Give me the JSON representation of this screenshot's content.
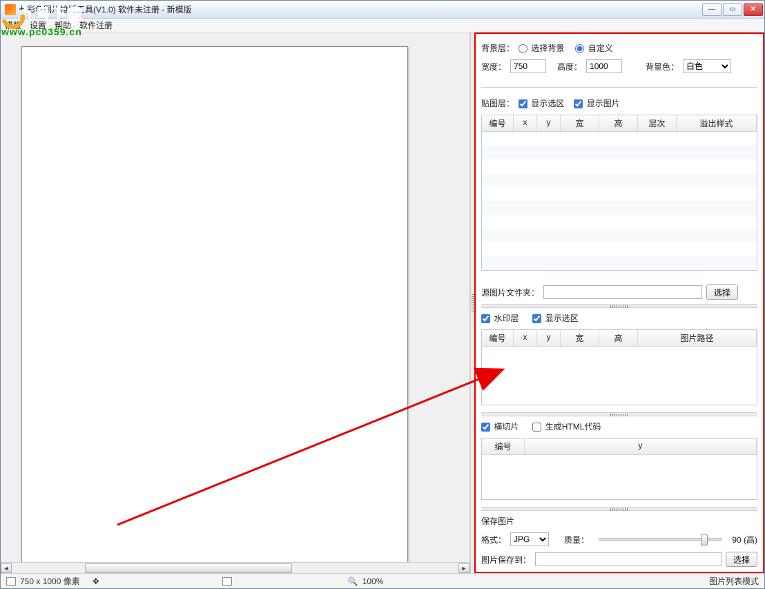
{
  "window": {
    "title": "七彩色图片排版工具(V1.0)    软件未注册 - 新模版"
  },
  "menu": {
    "template": "模版",
    "settings": "设置",
    "help": "帮助",
    "register": "软件注册"
  },
  "watermark": {
    "text1": "九号下载",
    "text2": "www.pc0359.cn"
  },
  "side": {
    "bg": {
      "label": "背景层：",
      "opt_select": "选择背景",
      "opt_custom": "自定义",
      "width_label": "宽度：",
      "width_value": "750",
      "height_label": "高度：",
      "height_value": "1000",
      "color_label": "背景色：",
      "color_value": "白色"
    },
    "paste": {
      "label": "贴图层：",
      "show_area": "显示选区",
      "show_img": "显示图片",
      "cols": {
        "num": "编号",
        "x": "x",
        "y": "y",
        "w": "宽",
        "h": "高",
        "lvl": "层次",
        "ov": "溢出样式"
      }
    },
    "srcfolder": {
      "label": "源图片文件夹：",
      "value": "",
      "btn": "选择"
    },
    "wm": {
      "label": "水印层",
      "show_area": "显示选区",
      "cols": {
        "num": "编号",
        "x": "x",
        "y": "y",
        "w": "宽",
        "h": "高",
        "path": "图片路径"
      }
    },
    "slice": {
      "label": "横切片",
      "gen_html": "生成HTML代码",
      "cols": {
        "num": "编号",
        "y": "y"
      }
    },
    "save": {
      "label": "保存图片",
      "fmt_label": "格式：",
      "fmt_value": "JPG",
      "quality_label": "质量：",
      "quality_text": "90 (高)",
      "saveto_label": "图片保存到：",
      "saveto_btn": "选择"
    }
  },
  "status": {
    "dims": "750 x 1000 像素",
    "zoom": "100%",
    "mode": "图片列表模式"
  }
}
